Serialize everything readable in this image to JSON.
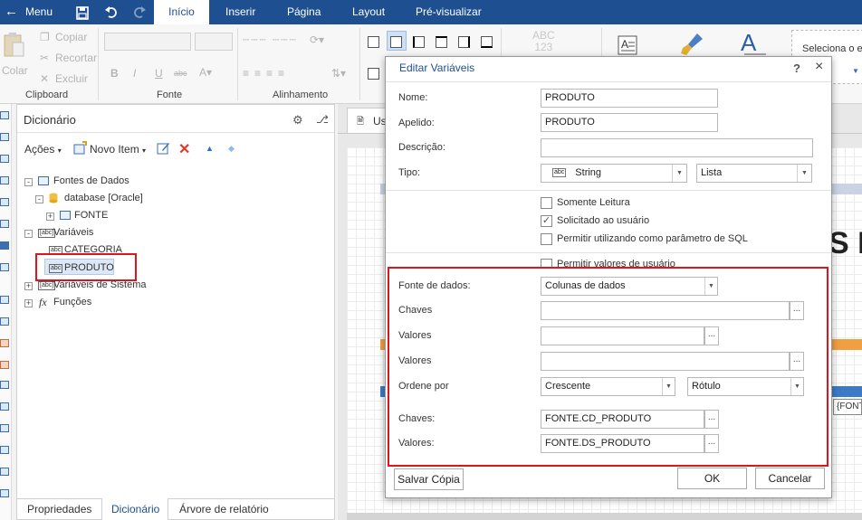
{
  "topbar": {
    "menu_label": "Menu",
    "tabs": [
      {
        "label": "Início"
      },
      {
        "label": "Inserir"
      },
      {
        "label": "Página"
      },
      {
        "label": "Layout"
      },
      {
        "label": "Pré-visualizar"
      }
    ]
  },
  "ribbon": {
    "clipboard": {
      "paste": "Colar",
      "copy": "Copiar",
      "cut": "Recortar",
      "delete": "Excluir",
      "label": "Clipboard"
    },
    "font_label": "Fonte",
    "alignment_label": "Alinhamento",
    "style_preview": "ABC\n123",
    "select_text": "Seleciona o e"
  },
  "dictionary": {
    "title": "Dicionário",
    "toolbar": {
      "actions": "Ações",
      "new_item": "Novo Item"
    },
    "tree": {
      "data_sources": "Fontes de Dados",
      "database": "database [Oracle]",
      "fonte": "FONTE",
      "variables": "Variáveis",
      "categoria": "CATEGORIA",
      "produto": "PRODUTO",
      "system_vars": "Variáveis de Sistema",
      "functions": "Funções"
    },
    "bottom_tabs": [
      {
        "label": "Propriedades"
      },
      {
        "label": "Dicionário"
      },
      {
        "label": "Árvore de relatório"
      }
    ]
  },
  "designer": {
    "tab_label": "Us",
    "big_text": "S F",
    "cell_text": "{FONT"
  },
  "dialog": {
    "title": "Editar Variáveis",
    "help": "?",
    "close": "×",
    "name_label": "Nome:",
    "name_value": "PRODUTO",
    "alias_label": "Apelido:",
    "alias_value": "PRODUTO",
    "desc_label": "Descrição:",
    "desc_value": "",
    "type_label": "Tipo:",
    "type_value": "String",
    "type_kind": "Lista",
    "readonly_label": "Somente Leitura",
    "readonly_checked": false,
    "requested_label": "Solicitado ao usuário",
    "requested_checked": true,
    "sql_param_label": "Permitir utilizando como parâmetro de SQL",
    "sql_param_checked": false,
    "allow_user_values_label": "Permitir valores de usuário",
    "allow_user_values_checked": false,
    "datasource_label": "Fonte de dados:",
    "datasource_value": "Colunas de dados",
    "keys_label": "Chaves",
    "keys_value": "",
    "values1_label": "Valores",
    "values1_value": "",
    "values2_label": "Valores",
    "values2_value": "",
    "order_label": "Ordene por",
    "order_value": "Crescente",
    "order_by_value": "Rótulo",
    "keys_col_label": "Chaves:",
    "keys_col_value": "FONTE.CD_PRODUTO",
    "values_col_label": "Valores:",
    "values_col_value": "FONTE.DS_PRODUTO",
    "dots": "...",
    "save_copy": "Salvar Cópia",
    "ok": "OK",
    "cancel": "Cancelar"
  }
}
